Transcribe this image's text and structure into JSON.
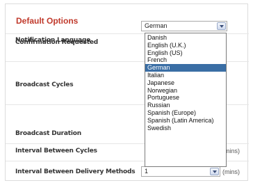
{
  "section": {
    "title": "Default Options"
  },
  "rows": [
    {
      "label": "Notification Language"
    },
    {
      "label": "Confirmation Requested"
    },
    {
      "label": "Broadcast Cycles"
    },
    {
      "label": "Broadcast Duration"
    },
    {
      "label": "Interval Between Cycles",
      "unit": "(mins)"
    },
    {
      "label": "Interval Between Delivery Methods",
      "value": "1",
      "unit": "(mins)"
    }
  ],
  "language_select": {
    "value": "German",
    "options": [
      "Danish",
      "English (U.K.)",
      "English (US)",
      "French",
      "German",
      "Italian",
      "Japanese",
      "Norwegian",
      "Portuguese",
      "Russian",
      "Spanish (Europe)",
      "Spanish (Latin America)",
      "Swedish"
    ]
  },
  "colors": {
    "title": "#c0392b",
    "highlight": "#3a6ea5"
  }
}
